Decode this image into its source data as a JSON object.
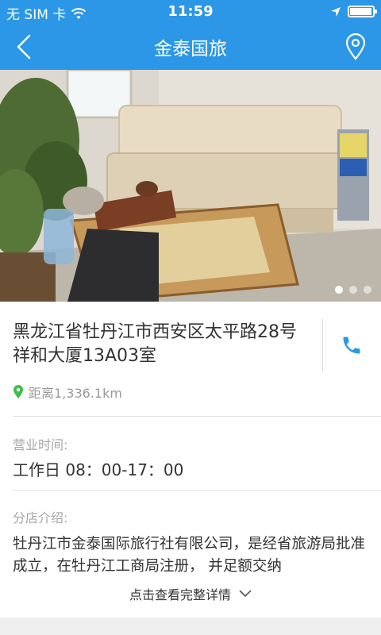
{
  "status_bar": {
    "carrier": "无 SIM 卡",
    "time": "11:59"
  },
  "header": {
    "title": "金泰国旅"
  },
  "gallery": {
    "count": 3,
    "active_index": 0
  },
  "store": {
    "address": "黑龙江省牡丹江市西安区太平路28号祥和大厦13A03室",
    "distance": "距离1,336.1km"
  },
  "hours": {
    "label": "营业时间:",
    "value": "工作日 08：00-17：00"
  },
  "intro": {
    "label": "分店介绍:",
    "text": "牡丹江市金泰国际旅行社有限公司，是经省旅游局批准成立，在牡丹江工商局注册， 并足额交纳",
    "more_label": "点击查看完整详情"
  },
  "colors": {
    "accent": "#2b97e6",
    "pin": "#3bbf4a"
  },
  "icons": [
    "wifi-icon",
    "back-icon",
    "location-pin-icon",
    "phone-icon",
    "map-pin-icon",
    "chevron-down-icon"
  ]
}
